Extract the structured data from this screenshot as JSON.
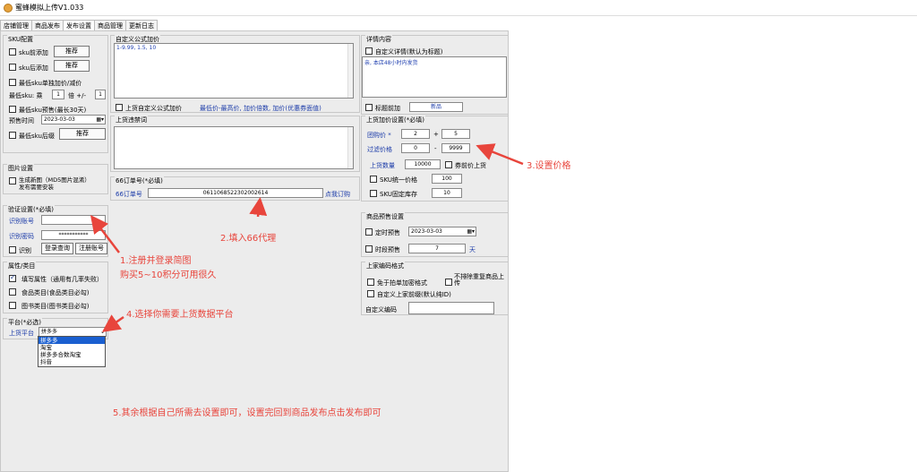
{
  "window": {
    "title": "蜜蜂模拟上传V1.033"
  },
  "tabs": [
    {
      "label": "店铺管理",
      "active": false
    },
    {
      "label": "商品发布",
      "active": false
    },
    {
      "label": "发布设置",
      "active": true
    },
    {
      "label": "商品管理",
      "active": false
    },
    {
      "label": "更新日志",
      "active": false
    }
  ],
  "sku": {
    "title": "SKU配置",
    "prefix_label": "sku前添加",
    "prefix_btn": "推荐",
    "suffix_label": "sku后添加",
    "suffix_btn": "推荐",
    "lowest_single_label": "最低sku单独加价/减价",
    "lowest_sku_label": "最低sku: 乘",
    "multiply_value": "1",
    "times_label": "倍 +/-",
    "plus_value": "1",
    "lowest_presale_label": "最低sku预售(最长30天)",
    "presale_time_label": "预售时间",
    "presale_date": "2023-03-03",
    "lowest_suffix_label": "最低sku后缀",
    "lowest_suffix_btn": "推荐"
  },
  "image": {
    "title": "图片设置",
    "gen_label": "生成新图（MD5图片混淆）",
    "gen_label2": "发布需要安装"
  },
  "verify": {
    "title": "验证设置(*必填)",
    "account_label": "识别账号",
    "account_value": "",
    "password_label": "识别密码",
    "password_value": "***********",
    "recognize_label": "识别",
    "login_btn": "登录查询",
    "register_btn": "注册账号"
  },
  "attr": {
    "title": "属性/类目",
    "fill_label": "填写属性（通用有几率失败）",
    "fill_checked": true,
    "food_label": "食品类目(食品类目必勾)",
    "book_label": "图书类目(图书类目必勾)"
  },
  "platform": {
    "title": "平台(*必选)",
    "label": "上货平台",
    "selected": "拼多多",
    "options": [
      "拼多多",
      "淘宝",
      "拼多多合数淘宝",
      "抖音"
    ]
  },
  "formula": {
    "title": "自定义公式加价",
    "content": "1-9.99, 1.5, 10",
    "checkbox_label": "上货自定义公式加价",
    "hint": "最低价-最高价, 加价倍数, 加价(优惠券面值)"
  },
  "banned": {
    "title": "上货违禁词"
  },
  "order": {
    "title": "66订单号(*必填)",
    "label": "66订单号",
    "value": "061106852230200261​4",
    "link": "点我订购"
  },
  "detail": {
    "title": "详情内容",
    "custom_label": "自定义详情(默认为标题)",
    "content": "亲, 本店48小时内发货",
    "title_prefix_label": "标题前加",
    "title_prefix_value": "新品"
  },
  "price": {
    "title": "上货加价设置(*必填)",
    "group_label": "团购价 *",
    "group_mult": "2",
    "plus": "+",
    "group_add": "5",
    "filter_label": "过滤价格",
    "filter_min": "0",
    "dash": "-",
    "filter_max": "9999",
    "qty_label": "上货数量",
    "qty_value": "10000",
    "coupon_label": "券前价上货",
    "sku_uniform_label": "SKU统一价格",
    "sku_uniform_value": "100",
    "sku_stock_label": "SKU固定库存",
    "sku_stock_value": "10"
  },
  "presale": {
    "title": "商品预售设置",
    "timed_label": "定时预售",
    "timed_date": "2023-03-03",
    "period_label": "时段预售",
    "period_value": "7",
    "period_unit": "天"
  },
  "merchant": {
    "title": "上家编码格式",
    "nocode_label": "免于拍单加密格式",
    "no_remove_label": "不排除重复商品上传",
    "custom_prefix_label": "自定义上家前缀(默认纯ID)",
    "custom_code_label": "自定义编码",
    "custom_code_value": ""
  },
  "annotations": {
    "a1_line1": "1.注册并登录简图",
    "a1_line2": "购买5~10积分可用很久",
    "a2": "2.填入66代理",
    "a3": "3.设置价格",
    "a4": "4.选择你需要上货数据平台",
    "a5": "5.其余根据自己所需去设置即可，设置完回到商品发布点击发布即可"
  },
  "colors": {
    "annotation": "#e8453c",
    "label_blue": "#1a3aa8",
    "selection": "#1a5fd0"
  }
}
